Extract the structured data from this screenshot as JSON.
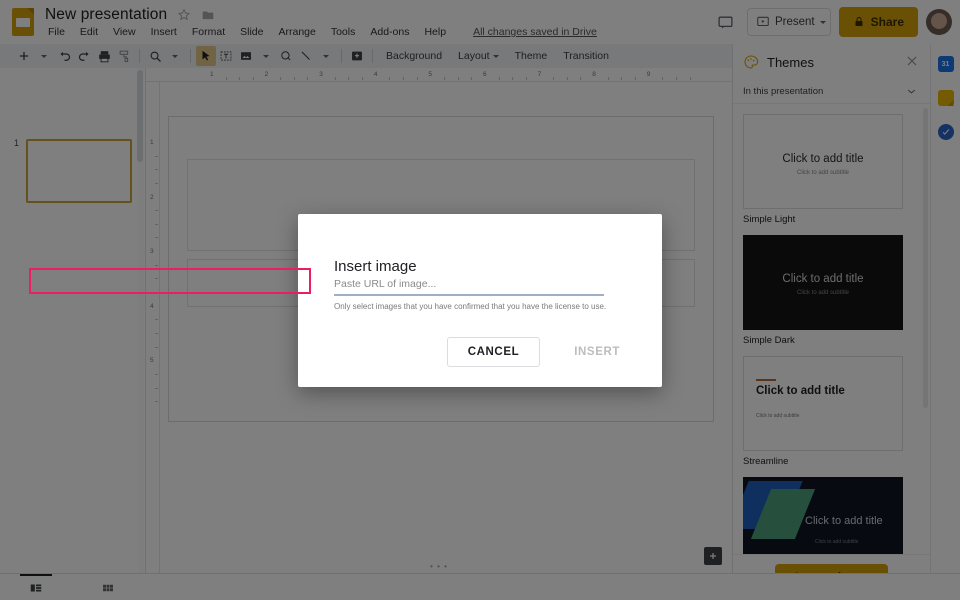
{
  "app": {
    "doc_title": "New presentation",
    "save_status": "All changes saved in Drive",
    "doc_icon": "slides-icon",
    "star_icon": "star-icon",
    "folder_icon": "folder-icon"
  },
  "menu": {
    "items": [
      {
        "label": "File"
      },
      {
        "label": "Edit"
      },
      {
        "label": "View"
      },
      {
        "label": "Insert"
      },
      {
        "label": "Format"
      },
      {
        "label": "Slide"
      },
      {
        "label": "Arrange"
      },
      {
        "label": "Tools"
      },
      {
        "label": "Add-ons"
      },
      {
        "label": "Help"
      }
    ]
  },
  "topright": {
    "comment_icon": "comment-icon",
    "present_label": "Present",
    "present_icon": "present-icon",
    "present_caret_icon": "chevron-down-icon",
    "share_label": "Share",
    "share_lock_icon": "lock-icon",
    "avatar": "avatar"
  },
  "toolbar": {
    "buttons": [
      {
        "name": "new-slide-button",
        "icon": "plus-icon"
      },
      {
        "name": "new-slide-dropdown",
        "icon": "chevron-down-icon"
      },
      {
        "name": "undo-button",
        "icon": "undo-icon"
      },
      {
        "name": "redo-button",
        "icon": "redo-icon"
      },
      {
        "name": "print-button",
        "icon": "printer-icon"
      },
      {
        "name": "paint-format-button",
        "icon": "paint-roller-icon"
      },
      {
        "name": "zoom-button",
        "icon": "magnifier-icon"
      },
      {
        "name": "zoom-dropdown",
        "icon": "chevron-down-icon"
      },
      {
        "name": "select-tool-button",
        "icon": "cursor-arrow-icon"
      },
      {
        "name": "text-box-button",
        "icon": "text-box-icon"
      },
      {
        "name": "insert-image-button",
        "icon": "image-icon"
      },
      {
        "name": "insert-image-dropdown",
        "icon": "chevron-down-icon"
      },
      {
        "name": "shape-button",
        "icon": "shape-icon"
      },
      {
        "name": "line-button",
        "icon": "line-icon"
      },
      {
        "name": "line-dropdown",
        "icon": "chevron-down-icon"
      },
      {
        "name": "add-comment-button",
        "icon": "add-comment-icon"
      }
    ],
    "background_label": "Background",
    "layout_label": "Layout",
    "theme_label": "Theme",
    "transition_label": "Transition",
    "collapse_icon": "chevron-up-icon"
  },
  "filmstrip": {
    "slide_number": "1"
  },
  "ruler": {
    "horizontal_ticks": [
      "1",
      "2",
      "3",
      "4",
      "5",
      "6",
      "7",
      "8",
      "9"
    ],
    "vertical_ticks": [
      "1",
      "2",
      "3",
      "4",
      "5"
    ]
  },
  "canvas": {
    "notes_icon": "add-notes-icon",
    "scroll_dots": "• • •"
  },
  "bottombar": {
    "filmstrip_view_icon": "filmstrip-view-icon",
    "grid_view_icon": "grid-view-icon"
  },
  "themes_panel": {
    "title": "Themes",
    "close_icon": "close-icon",
    "filter_label": "In this presentation",
    "filter_caret_icon": "chevron-down-icon",
    "import_label": "Import theme",
    "expand_icon": "chevron-right-icon",
    "themes": [
      {
        "name": "Simple Light",
        "style": "light",
        "title_text": "Click to add title",
        "subtitle_text": "Click to add subtitle"
      },
      {
        "name": "Simple Dark",
        "style": "dark",
        "title_text": "Click to add title",
        "subtitle_text": "Click to add subtitle"
      },
      {
        "name": "Streamline",
        "style": "streamline",
        "title_text": "Click to add title",
        "subtitle_text": "Click to add subtitle"
      },
      {
        "name": "",
        "style": "geo",
        "title_text": "Click to add title",
        "subtitle_text": "Click to add subtitle"
      }
    ]
  },
  "app_rail": {
    "items": [
      {
        "name": "google-calendar-icon",
        "label": "31"
      },
      {
        "name": "google-keep-icon",
        "label": ""
      },
      {
        "name": "google-tasks-icon",
        "label": ""
      }
    ]
  },
  "modal": {
    "title": "Insert image",
    "url_placeholder": "Paste URL of image...",
    "url_value": "",
    "license_note": "Only select images that you have confirmed that you have the license to use.",
    "cancel_label": "CANCEL",
    "insert_label": "INSERT",
    "highlight_color": "#E91E63"
  }
}
